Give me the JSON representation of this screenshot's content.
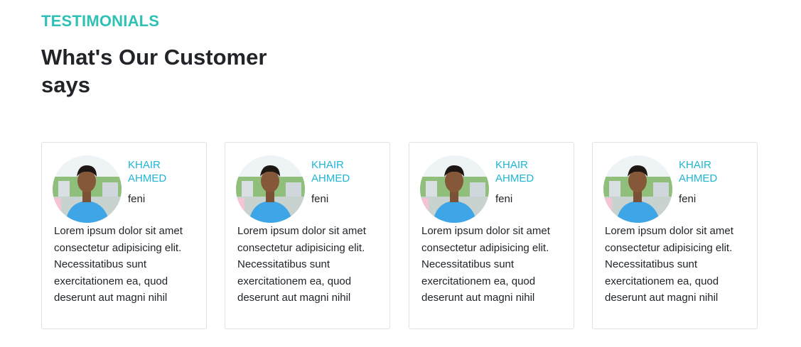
{
  "section": {
    "eyebrow": "TESTIMONIALS",
    "heading": "What's Our Customer says"
  },
  "testimonials": [
    {
      "name": "KHAIR AHMED",
      "location": "feni",
      "text": "Lorem ipsum dolor sit amet consectetur adipisicing elit. Necessitatibus sunt exercitationem ea, quod deserunt aut magni nihil"
    },
    {
      "name": "KHAIR AHMED",
      "location": "feni",
      "text": "Lorem ipsum dolor sit amet consectetur adipisicing elit. Necessitatibus sunt exercitationem ea, quod deserunt aut magni nihil"
    },
    {
      "name": "KHAIR AHMED",
      "location": "feni",
      "text": "Lorem ipsum dolor sit amet consectetur adipisicing elit. Necessitatibus sunt exercitationem ea, quod deserunt aut magni nihil"
    },
    {
      "name": "KHAIR AHMED",
      "location": "feni",
      "text": "Lorem ipsum dolor sit amet consectetur adipisicing elit. Necessitatibus sunt exercitationem ea, quod deserunt aut magni nihil"
    }
  ],
  "colors": {
    "eyebrow": "#2fc0b6",
    "name": "#1fb6d6",
    "card_border": "#dfe3e6"
  }
}
